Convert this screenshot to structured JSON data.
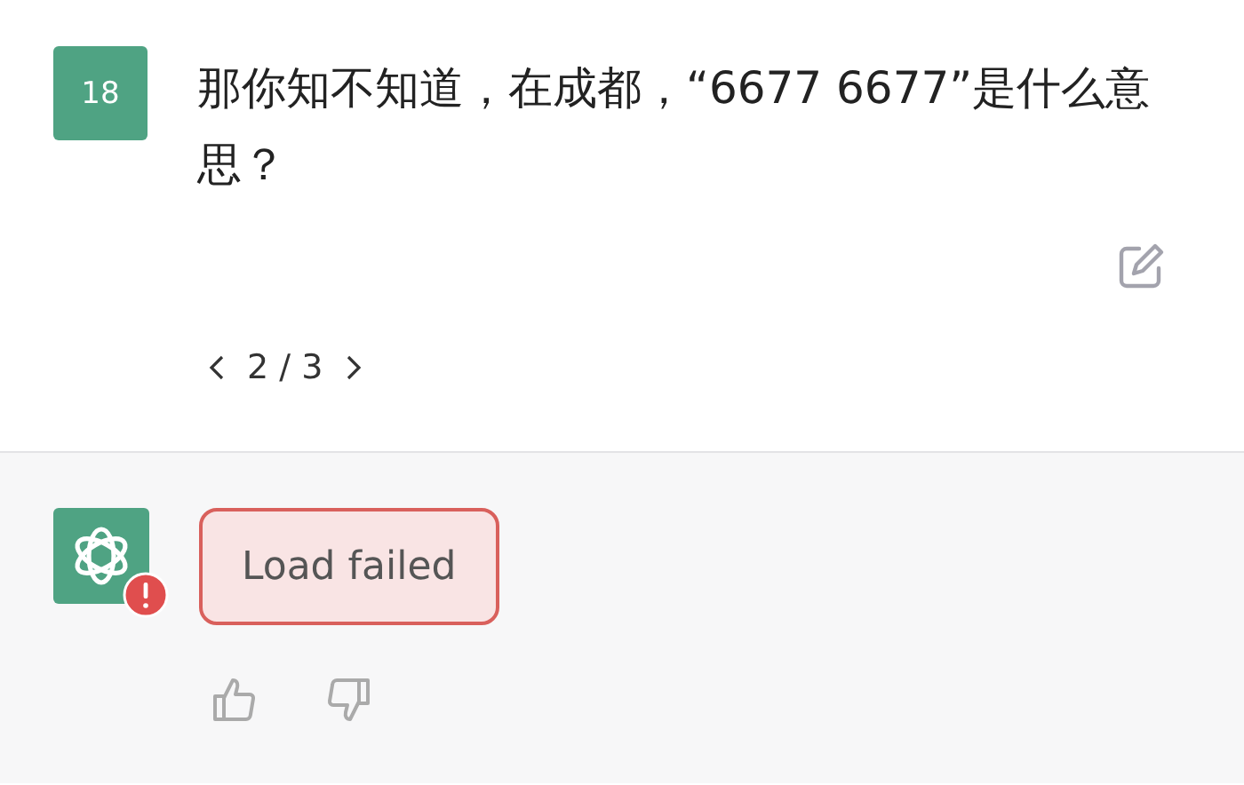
{
  "user_message": {
    "avatar_text": "18",
    "text": "那你知不知道，在成都，“6677 6677”是什么意思？"
  },
  "pager": {
    "text": "2 / 3"
  },
  "assistant_message": {
    "error": true,
    "text": "Load failed"
  }
}
